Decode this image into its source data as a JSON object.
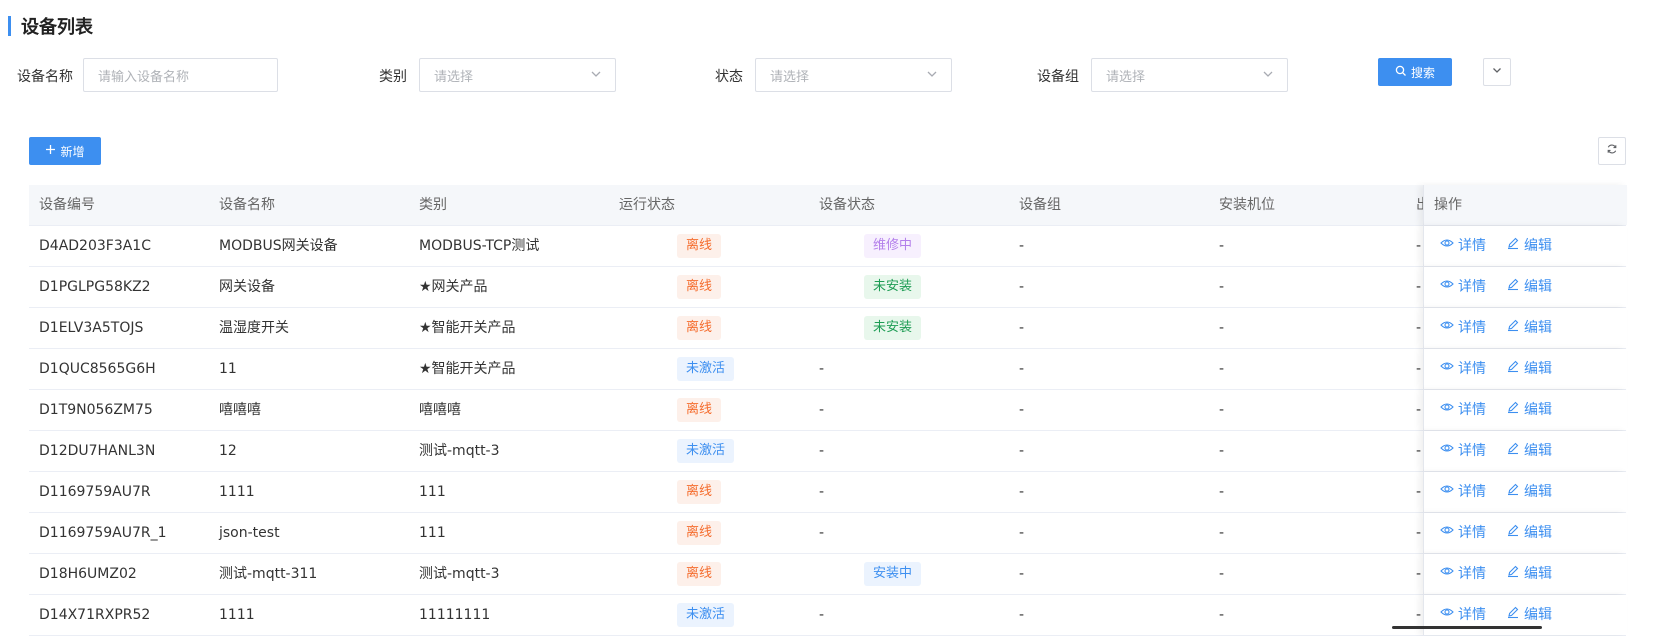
{
  "page": {
    "title": "设备列表"
  },
  "filters": {
    "name_label": "设备名称",
    "name_placeholder": "请输入设备名称",
    "category_label": "类别",
    "category_placeholder": "请选择",
    "status_label": "状态",
    "status_placeholder": "请选择",
    "group_label": "设备组",
    "group_placeholder": "请选择",
    "search_label": "搜索"
  },
  "toolbar": {
    "add_label": "新增"
  },
  "table": {
    "headers": [
      "设备编号",
      "设备名称",
      "类别",
      "运行状态",
      "设备状态",
      "设备组",
      "安装机位",
      "出",
      "操作"
    ],
    "actions": {
      "detail": "详情",
      "edit": "编辑"
    },
    "rows": [
      {
        "id": "D4AD203F3A1C",
        "name": "MODBUS网关设备",
        "category": "MODBUS-TCP测试",
        "run": "离线",
        "device": "维修中",
        "group": "-",
        "slot": "-",
        "out": "-"
      },
      {
        "id": "D1PGLPG58KZ2",
        "name": "网关设备",
        "category": "★网关产品",
        "run": "离线",
        "device": "未安装",
        "group": "-",
        "slot": "-",
        "out": "-"
      },
      {
        "id": "D1ELV3A5TOJS",
        "name": "温湿度开关",
        "category": "★智能开关产品",
        "run": "离线",
        "device": "未安装",
        "group": "-",
        "slot": "-",
        "out": "-"
      },
      {
        "id": "D1QUC8565G6H",
        "name": "11",
        "category": "★智能开关产品",
        "run": "未激活",
        "device": "-",
        "group": "-",
        "slot": "-",
        "out": "-"
      },
      {
        "id": "D1T9N056ZM75",
        "name": "嘻嘻嘻",
        "category": "嘻嘻嘻",
        "run": "离线",
        "device": "-",
        "group": "-",
        "slot": "-",
        "out": "-"
      },
      {
        "id": "D12DU7HANL3N",
        "name": "12",
        "category": "测试-mqtt-3",
        "run": "未激活",
        "device": "-",
        "group": "-",
        "slot": "-",
        "out": "-"
      },
      {
        "id": "D1169759AU7R",
        "name": "1111",
        "category": "111",
        "run": "离线",
        "device": "-",
        "group": "-",
        "slot": "-",
        "out": "-"
      },
      {
        "id": "D1169759AU7R_1",
        "name": "json-test",
        "category": "111",
        "run": "离线",
        "device": "-",
        "group": "-",
        "slot": "-",
        "out": "-"
      },
      {
        "id": "D18H6UMZ02",
        "name": "测试-mqtt-311",
        "category": "测试-mqtt-3",
        "run": "离线",
        "device": "安装中",
        "group": "-",
        "slot": "-",
        "out": "-"
      },
      {
        "id": "D14X71RXPR52",
        "name": "1111",
        "category": "11111111",
        "run": "未激活",
        "device": "-",
        "group": "-",
        "slot": "-",
        "out": "-"
      }
    ]
  },
  "tag_styles": {
    "离线": {
      "color": "#f56c2d",
      "bg": "#fdf0ea"
    },
    "未激活": {
      "color": "#3d8ff0",
      "bg": "#ebf3fe"
    },
    "维修中": {
      "color": "#b37feb",
      "bg": "#f7f0fe"
    },
    "未安装": {
      "color": "#1f9d55",
      "bg": "#e8f7ec"
    },
    "安装中": {
      "color": "#3d8ff0",
      "bg": "#ebf3fe"
    }
  }
}
